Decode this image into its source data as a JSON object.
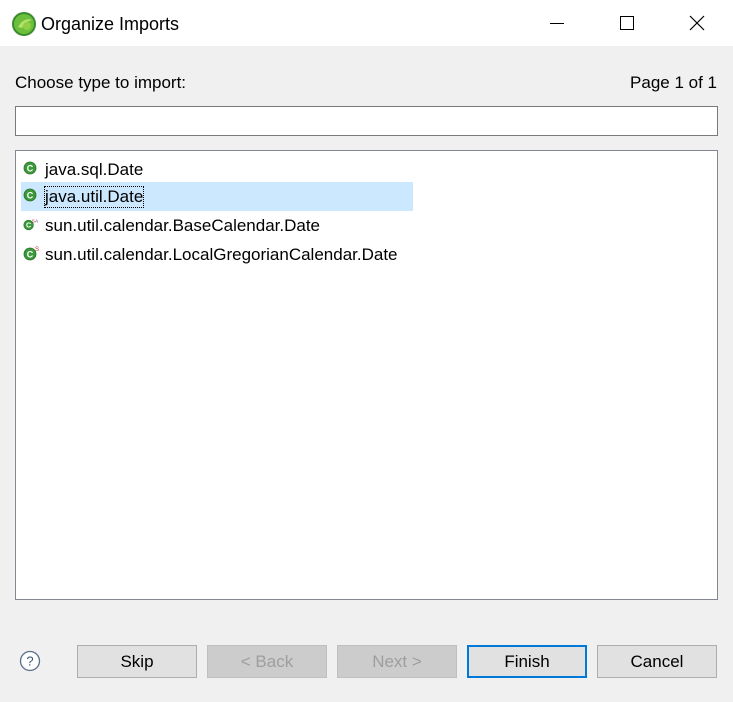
{
  "window": {
    "title": "Organize Imports",
    "icon": "eclipse-icon"
  },
  "dialog": {
    "choose_label": "Choose type to import:",
    "page_label": "Page 1 of 1",
    "filter_value": "",
    "types": [
      {
        "label": "java.sql.Date",
        "icon": "class-icon",
        "selected": false
      },
      {
        "label": "java.util.Date",
        "icon": "class-icon",
        "selected": true
      },
      {
        "label": "sun.util.calendar.BaseCalendar.Date",
        "icon": "static-abstract-class-icon",
        "selected": false
      },
      {
        "label": "sun.util.calendar.LocalGregorianCalendar.Date",
        "icon": "static-class-icon",
        "selected": false
      }
    ]
  },
  "buttons": {
    "skip": "Skip",
    "back": "< Back",
    "next": "Next >",
    "finish": "Finish",
    "cancel": "Cancel"
  },
  "colors": {
    "selection": "#cce8ff",
    "class_icon": "#3a9a3a",
    "default_button_border": "#0078d7"
  }
}
